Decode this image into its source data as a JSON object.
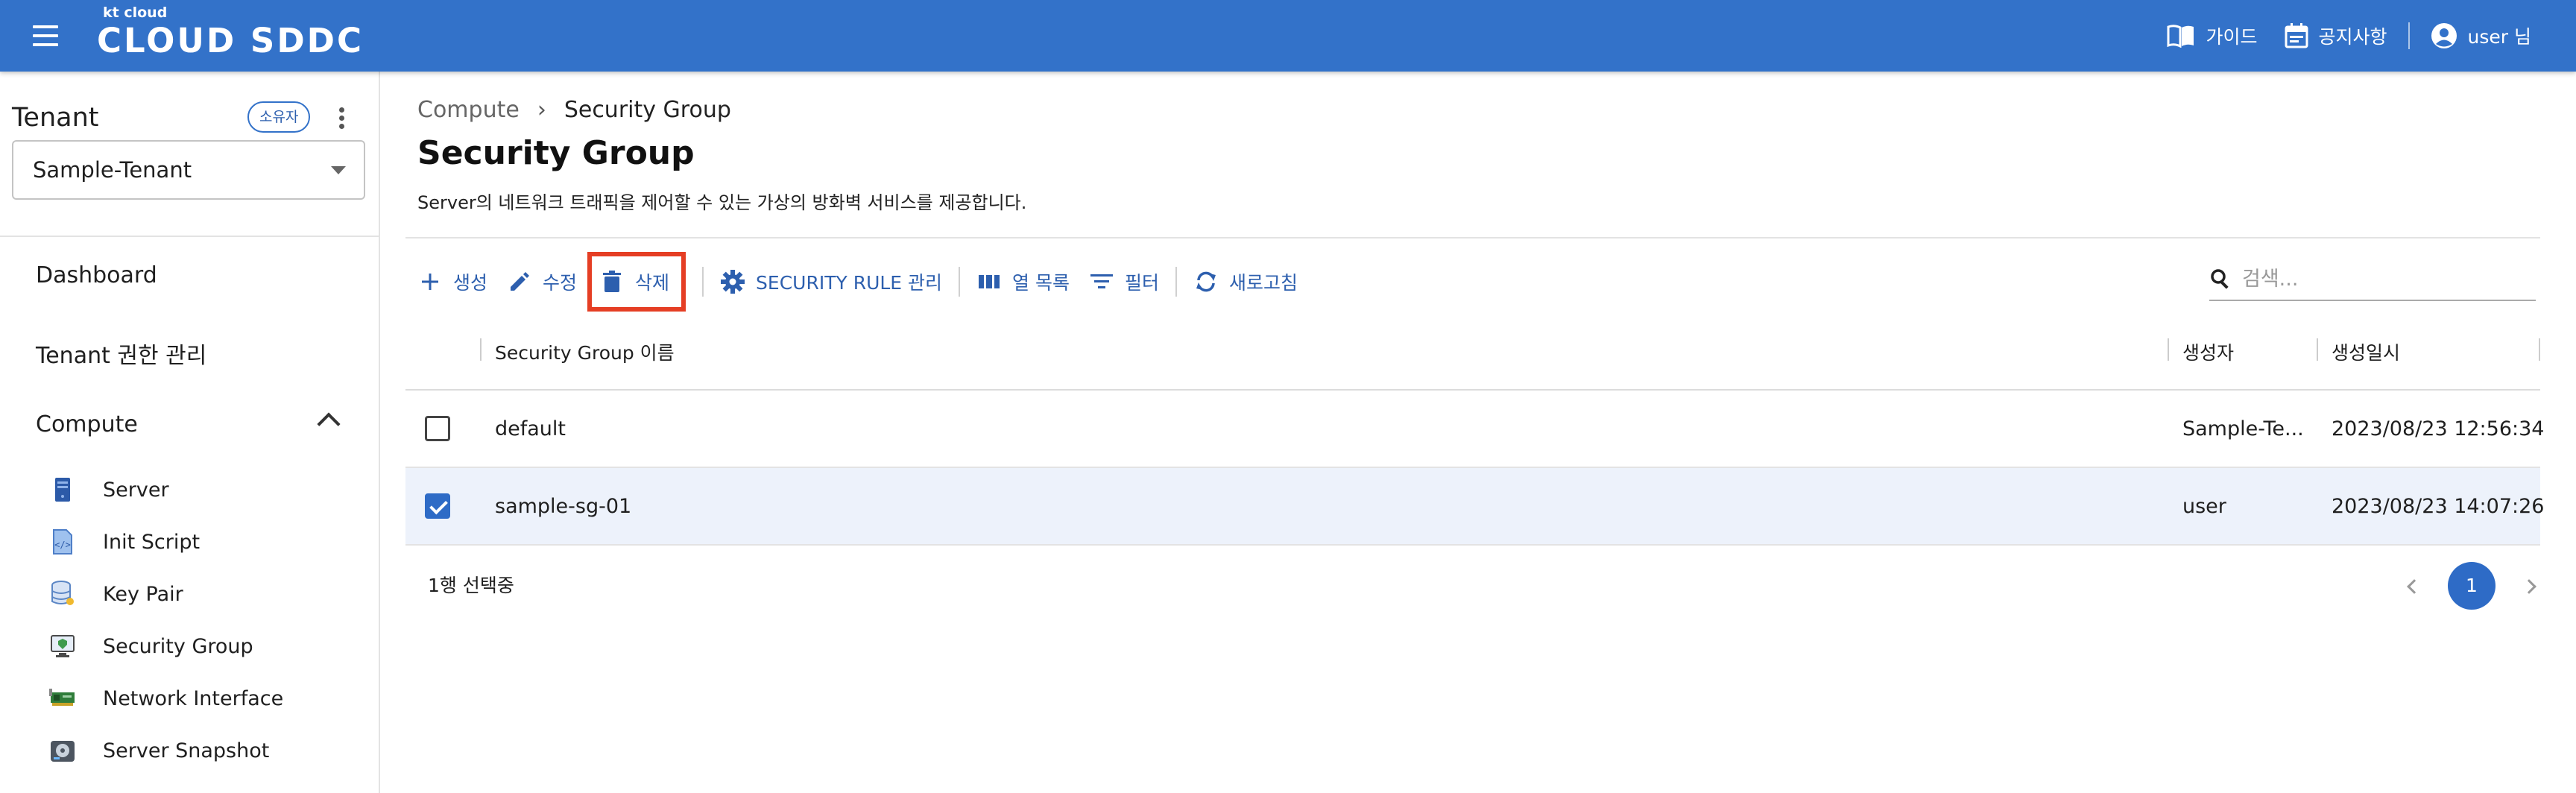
{
  "header": {
    "logo_small": "kt cloud",
    "logo_main": "CLOUD SDDC",
    "guide_label": "가이드",
    "notice_label": "공지사항",
    "user_label": "user 님"
  },
  "sidebar": {
    "tenant_title": "Tenant",
    "owner_badge": "소유자",
    "tenant_value": "Sample-Tenant",
    "nav": {
      "dashboard": "Dashboard",
      "tenant_permission": "Tenant 권한 관리",
      "compute": "Compute"
    },
    "compute_items": [
      {
        "label": "Server",
        "icon": "server-icon"
      },
      {
        "label": "Init Script",
        "icon": "script-file-icon"
      },
      {
        "label": "Key Pair",
        "icon": "database-key-icon"
      },
      {
        "label": "Security Group",
        "icon": "monitor-shield-icon"
      },
      {
        "label": "Network Interface",
        "icon": "network-card-icon"
      },
      {
        "label": "Server Snapshot",
        "icon": "disk-snapshot-icon"
      }
    ]
  },
  "main": {
    "breadcrumb": [
      "Compute",
      "Security Group"
    ],
    "title": "Security Group",
    "description": "Server의 네트워크 트래픽을 제어할 수 있는 가상의 방화벽 서비스를 제공합니다.",
    "toolbar": {
      "create": "생성",
      "edit": "수정",
      "delete": "삭제",
      "security_rule": "SECURITY RULE 관리",
      "columns": "열 목록",
      "filter": "필터",
      "refresh": "새로고침"
    },
    "search_placeholder": "검색...",
    "table": {
      "columns": [
        "Security Group 이름",
        "생성자",
        "생성일시"
      ],
      "rows": [
        {
          "name": "default",
          "creator": "Sample-Te...",
          "created": "2023/08/23 12:56:34",
          "checked": false
        },
        {
          "name": "sample-sg-01",
          "creator": "user",
          "created": "2023/08/23 14:07:26",
          "checked": true
        }
      ]
    },
    "selected_count": "1행 선택중",
    "pagination": {
      "current_page": "1"
    }
  },
  "colors": {
    "brand_blue": "#3372c9",
    "highlight_red": "#e53e24",
    "selected_row": "#edf2fb"
  }
}
